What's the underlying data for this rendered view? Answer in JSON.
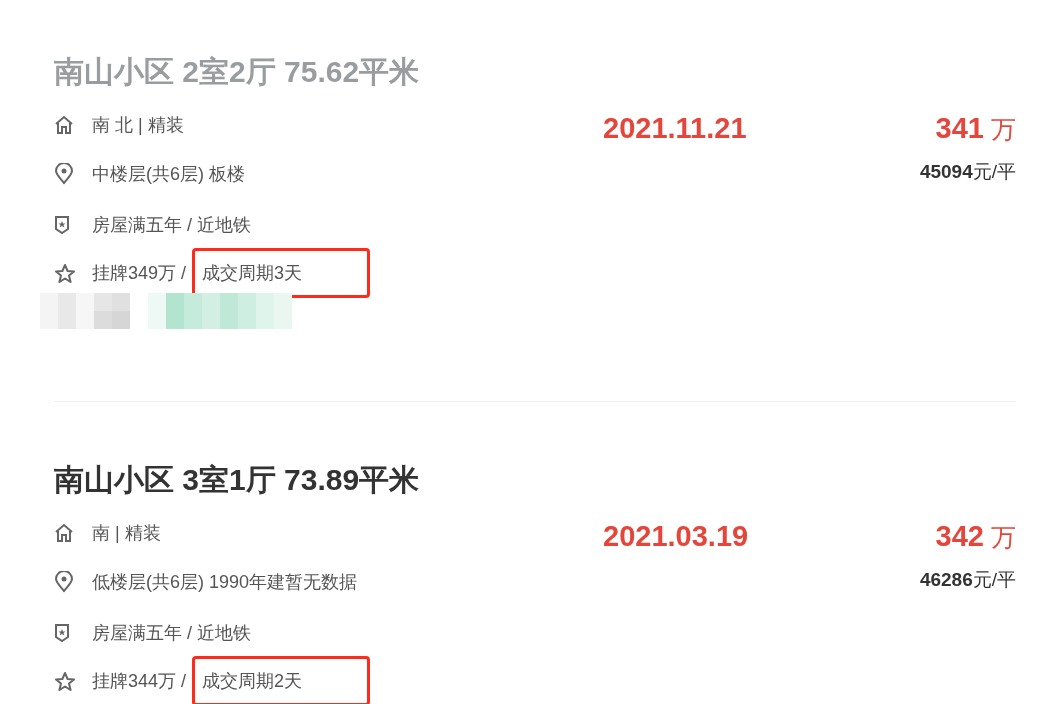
{
  "listings": [
    {
      "title": "南山小区 2室2厅 75.62平米",
      "dimmed": true,
      "orientation": "南 北 | 精装",
      "floor": "中楼层(共6层) 板楼",
      "features": "房屋满五年 / 近地铁",
      "listing_price": "挂牌349万 /",
      "deal_cycle": "成交周期3天",
      "deal_cycle_highlighted": true,
      "tags_blurred": true,
      "deal_date": "2021.11.21",
      "total_price": "341",
      "total_unit": "万",
      "unit_price": "45094",
      "unit_price_suffix": "元/平"
    },
    {
      "title": "南山小区 3室1厅 73.89平米",
      "dimmed": false,
      "orientation": "南 | 精装",
      "floor": "低楼层(共6层) 1990年建暂无数据",
      "features": "房屋满五年 / 近地铁",
      "listing_price": "挂牌344万 /",
      "deal_cycle": "成交周期2天",
      "deal_cycle_highlighted": true,
      "tags_blurred": false,
      "deal_date": "2021.03.19",
      "total_price": "342",
      "total_unit": "万",
      "unit_price": "46286",
      "unit_price_suffix": "元/平"
    }
  ]
}
